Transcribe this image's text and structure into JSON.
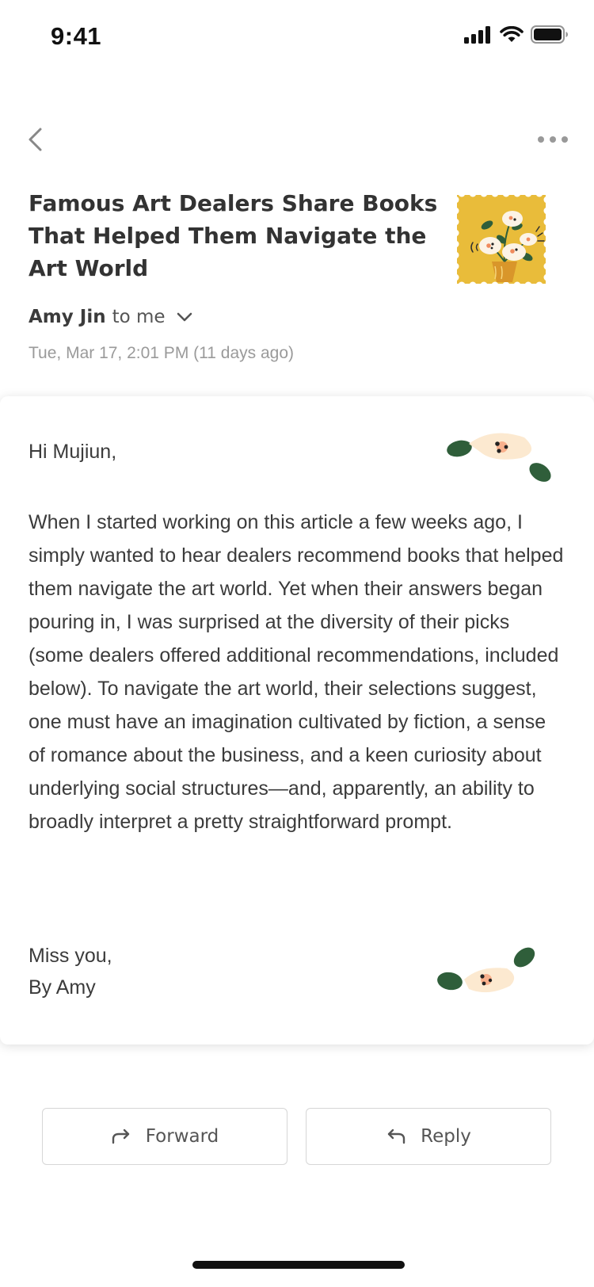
{
  "status_bar": {
    "time": "9:41"
  },
  "nav": {
    "back_icon": "chevron-left-icon",
    "more_icon": "more-horizontal-icon"
  },
  "email": {
    "subject": "Famous Art Dealers Share Books That Helped Them Navigate the Art World",
    "sender_name": "Amy Jin",
    "recipient_text": "to me",
    "date": "Tue, Mar 17, 2:01 PM (11 days ago)",
    "greeting": "Hi Mujiun,",
    "body": "When I started working on this article a few weeks ago, I simply wanted to hear dealers recommend books that helped them navigate the art world. Yet when their answers began pouring in, I was surprised at the diversity of their picks (some dealers offered additional recommendations, included below). To navigate the art world, their selections suggest, one must have an imagination cultivated by fiction, a sense of romance about the business, and a keen curiosity about underlying social structures—and, apparently, an ability to broadly interpret a pretty straightforward prompt.",
    "signoff_line1": "Miss you,",
    "signoff_line2": "By Amy"
  },
  "actions": {
    "forward_label": "Forward",
    "reply_label": "Reply"
  },
  "colors": {
    "stamp_yellow": "#E9BC3A",
    "leaf_green": "#2F5E3A",
    "petal_cream": "#FCE9D0",
    "accent_orange": "#F08A5D",
    "text_dark": "#333333",
    "text_muted": "#9A9A9A"
  }
}
